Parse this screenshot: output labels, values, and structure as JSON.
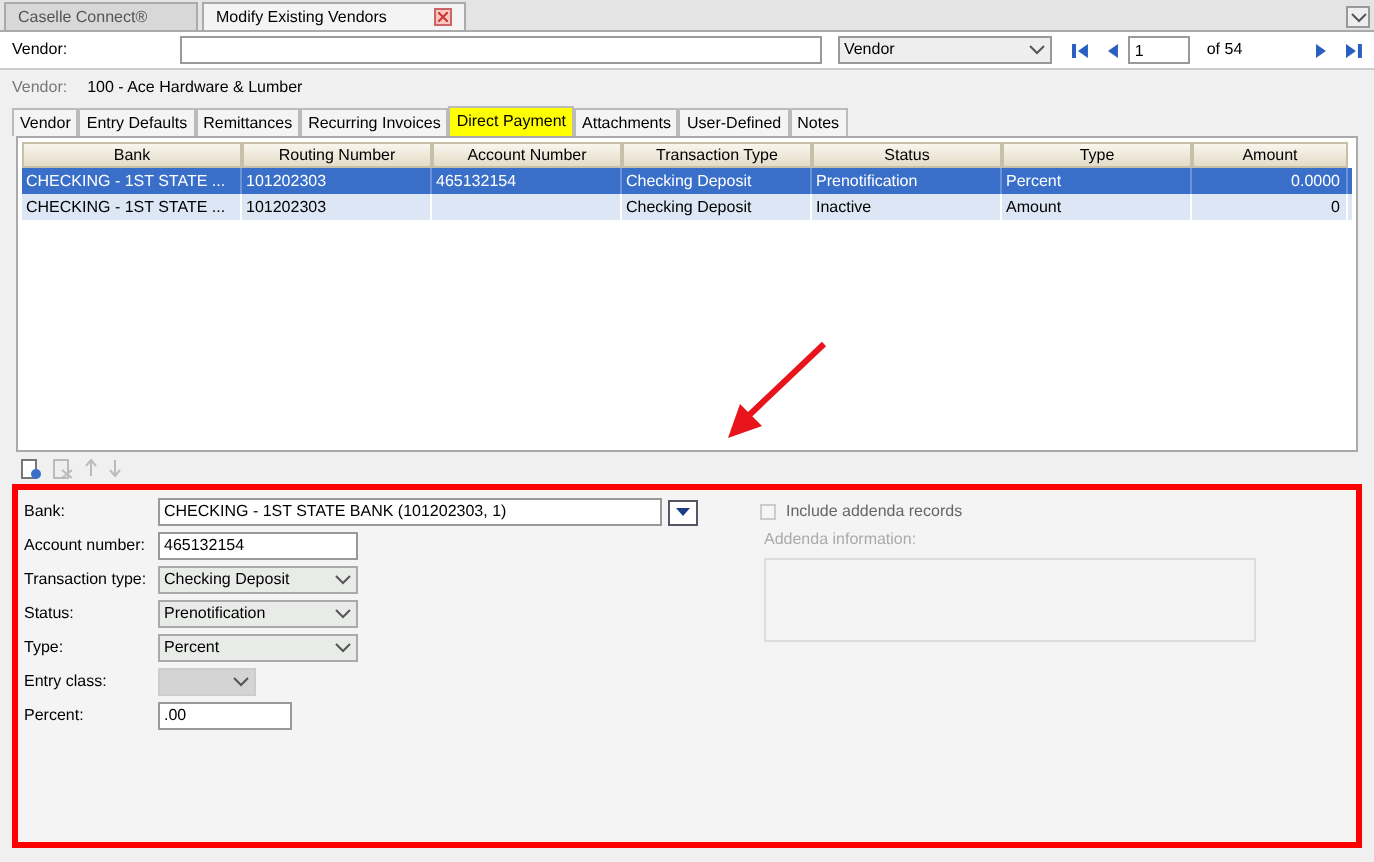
{
  "doc_tabs": [
    {
      "label": "Caselle Connect®",
      "selected": false,
      "closable": false
    },
    {
      "label": "Modify Existing Vendors",
      "selected": true,
      "closable": true
    }
  ],
  "search": {
    "label": "Vendor:",
    "field_option": "Vendor",
    "record": "1",
    "record_count": "of 54"
  },
  "vendor_info": {
    "label": "Vendor:",
    "value": "100  - Ace Hardware & Lumber"
  },
  "tabs": [
    {
      "label": "Vendor",
      "selected": false
    },
    {
      "label": "Entry Defaults",
      "selected": false
    },
    {
      "label": "Remittances",
      "selected": false
    },
    {
      "label": "Recurring Invoices",
      "selected": false
    },
    {
      "label": "Direct Payment",
      "selected": true
    },
    {
      "label": "Attachments",
      "selected": false
    },
    {
      "label": "User-Defined",
      "selected": false
    },
    {
      "label": "Notes",
      "selected": false
    }
  ],
  "table": {
    "columns": [
      "Bank",
      "Routing Number",
      "Account Number",
      "Transaction Type",
      "Status",
      "Type",
      "Amount"
    ],
    "rows": [
      {
        "selected": true,
        "cells": [
          "CHECKING - 1ST STATE ...",
          "101202303",
          "465132154",
          "Checking Deposit",
          "Prenotification",
          "Percent",
          "0.0000"
        ]
      },
      {
        "selected": false,
        "cells": [
          "CHECKING - 1ST STATE ...",
          "101202303",
          "",
          "Checking Deposit",
          "Inactive",
          "Amount",
          "0"
        ]
      }
    ]
  },
  "form": {
    "fields": [
      {
        "label": "Bank:",
        "kind": "lookup",
        "value": "CHECKING - 1ST STATE BANK (101202303, 1)",
        "disabled": false
      },
      {
        "label": "Account number:",
        "kind": "text",
        "value": "465132154",
        "disabled": false
      },
      {
        "label": "Transaction type:",
        "kind": "select",
        "value": "Checking Deposit",
        "disabled": false
      },
      {
        "label": "Status:",
        "kind": "select",
        "value": "Prenotification",
        "disabled": false
      },
      {
        "label": "Type:",
        "kind": "select",
        "value": "Percent",
        "disabled": false
      },
      {
        "label": "Entry class:",
        "kind": "select",
        "disabled": true
      },
      {
        "label": "Percent:",
        "kind": "text",
        "value": ".00",
        "disabled": false
      }
    ],
    "include_addenda": {
      "label": "Include addenda records",
      "checked": false,
      "disabled": true
    },
    "addenda": {
      "label": "Addenda information:",
      "disabled": true
    }
  }
}
